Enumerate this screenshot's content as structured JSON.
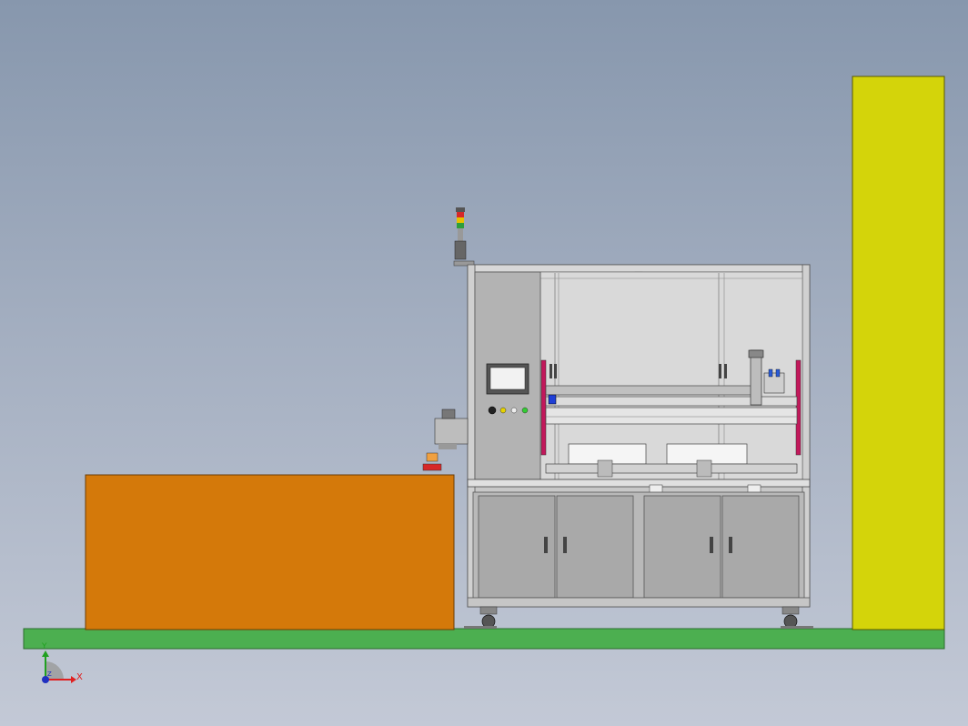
{
  "triad": {
    "x_label": "X",
    "y_label": "Y",
    "z_label": "Z"
  },
  "colors": {
    "floor": "#4caf50",
    "left_block": "#d4790a",
    "right_pillar": "#d4d40a",
    "machine_frame": "#b9b9b9",
    "cabinet_panel": "#a9a9a9",
    "light_curtain": "#c2185b"
  }
}
